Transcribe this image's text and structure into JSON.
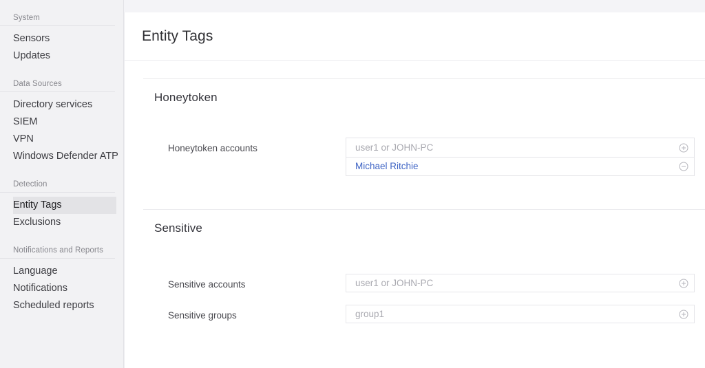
{
  "sidebar": {
    "groups": [
      {
        "title": "System",
        "items": [
          {
            "label": "Sensors",
            "active": false
          },
          {
            "label": "Updates",
            "active": false
          }
        ]
      },
      {
        "title": "Data Sources",
        "items": [
          {
            "label": "Directory services",
            "active": false
          },
          {
            "label": "SIEM",
            "active": false
          },
          {
            "label": "VPN",
            "active": false
          },
          {
            "label": "Windows Defender ATP",
            "active": false
          }
        ]
      },
      {
        "title": "Detection",
        "items": [
          {
            "label": "Entity Tags",
            "active": true
          },
          {
            "label": "Exclusions",
            "active": false
          }
        ]
      },
      {
        "title": "Notifications and Reports",
        "items": [
          {
            "label": "Language",
            "active": false
          },
          {
            "label": "Notifications",
            "active": false
          },
          {
            "label": "Scheduled reports",
            "active": false
          }
        ]
      }
    ]
  },
  "page": {
    "title": "Entity Tags"
  },
  "honeytoken": {
    "heading": "Honeytoken",
    "accounts": {
      "label": "Honeytoken accounts",
      "placeholder": "user1 or JOHN-PC",
      "add_icon": "plus-circle-icon",
      "remove_icon": "minus-circle-icon",
      "values": [
        {
          "text": "Michael Ritchie"
        }
      ]
    }
  },
  "sensitive": {
    "heading": "Sensitive",
    "accounts": {
      "label": "Sensitive accounts",
      "placeholder": "user1 or JOHN-PC",
      "add_icon": "plus-circle-icon"
    },
    "groups": {
      "label": "Sensitive groups",
      "placeholder": "group1",
      "add_icon": "plus-circle-icon"
    }
  },
  "colors": {
    "link": "#3d63c4",
    "placeholder": "#a9a9b0",
    "sidebar_active_bg": "#e3e3e6",
    "page_bg": "#f4f4f7",
    "panel_bg": "#ffffff",
    "divider": "#ebebee"
  }
}
